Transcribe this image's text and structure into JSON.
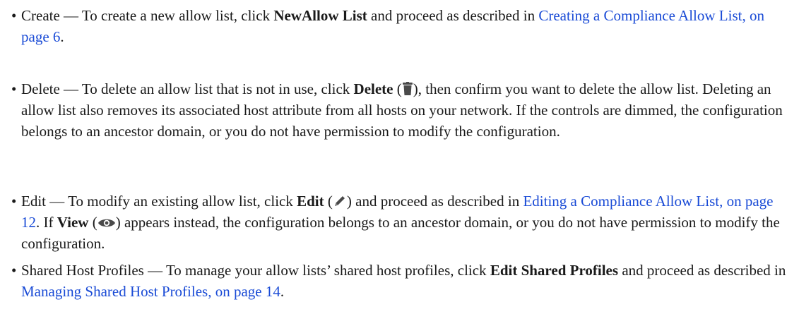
{
  "bullet": "•",
  "items": [
    {
      "name": "Create",
      "dash": " — To create a new allow list, click ",
      "bold": "NewAllow List",
      "mid": " and proceed as described in ",
      "link": "Creating a Compliance Allow List, on page 6",
      "end": "."
    },
    {
      "name": "Delete",
      "dash": " — To delete an allow list that is not in use, click ",
      "bold": "Delete",
      "paren_open": " (",
      "icon": "trash-icon",
      "paren_close": "),",
      "rest": " then confirm you want to delete the allow list. Deleting an allow list also removes its associated host attribute from all hosts on your network. If the controls are dimmed, the configuration belongs to an ancestor domain, or you do not have permission to modify the configuration."
    },
    {
      "name": "Edit",
      "dash": " — To modify an existing allow list, click ",
      "bold": "Edit",
      "paren_open": " (",
      "icon": "pencil-icon",
      "paren_close": ")",
      "mid": " and proceed as described in ",
      "link": "Editing a Compliance Allow List, on page 12",
      "after_link": ". If ",
      "bold2": "View",
      "paren_open2": " (",
      "icon2": "eye-icon",
      "paren_close2": ")",
      "rest": " appears instead, the configuration belongs to an ancestor domain, or you do not have permission to modify the configuration."
    },
    {
      "name": "Shared Host Profiles",
      "dash": " — To manage your allow lists’ shared host profiles, click ",
      "bold": "Edit Shared Profiles",
      "mid": " and proceed as described in ",
      "link": "Managing Shared Host Profiles, on page 14",
      "end": "."
    }
  ],
  "colors": {
    "text": "#1a1a1a",
    "link": "#1a4bd6",
    "icon": "#4a4a4a"
  }
}
